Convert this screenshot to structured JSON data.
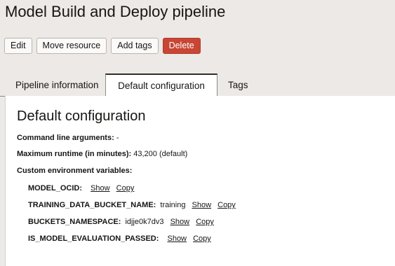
{
  "page": {
    "title": "Model Build and Deploy pipeline"
  },
  "actions": {
    "edit": "Edit",
    "move": "Move resource",
    "add_tags": "Add tags",
    "delete": "Delete"
  },
  "tabs": [
    {
      "label": "Pipeline information",
      "active": false
    },
    {
      "label": "Default configuration",
      "active": true
    },
    {
      "label": "Tags",
      "active": false
    }
  ],
  "section": {
    "title": "Default configuration",
    "command_line": {
      "label": "Command line arguments:",
      "value": "-"
    },
    "max_runtime": {
      "label": "Maximum runtime (in minutes):",
      "value": "43,200 (default)"
    },
    "env_label": "Custom environment variables:",
    "env_vars": [
      {
        "name": "MODEL_OCID:",
        "value": "",
        "show": "Show",
        "copy": "Copy"
      },
      {
        "name": "TRAINING_DATA_BUCKET_NAME:",
        "value": "training",
        "show": "Show",
        "copy": "Copy"
      },
      {
        "name": "BUCKETS_NAMESPACE:",
        "value": "idjje0k7dv3",
        "show": "Show",
        "copy": "Copy"
      },
      {
        "name": "IS_MODEL_EVALUATION_PASSED:",
        "value": "",
        "show": "Show",
        "copy": "Copy"
      }
    ]
  },
  "colors": {
    "page_background": "#ece9e6",
    "danger": "#c74634",
    "panel": "#ffffff",
    "text": "#161513"
  }
}
